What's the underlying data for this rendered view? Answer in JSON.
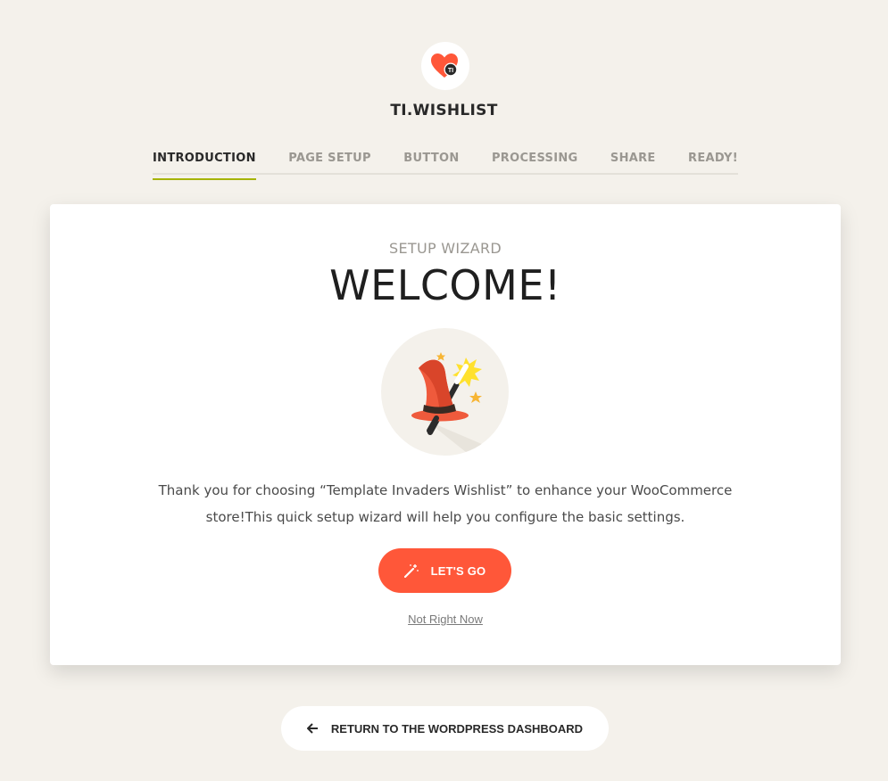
{
  "brand": {
    "name": "TI.WISHLIST",
    "logo_icon": "heart-logo-icon",
    "logo_text": "TI",
    "logo_color": "#ff5739"
  },
  "steps": [
    {
      "label": "INTRODUCTION",
      "active": true
    },
    {
      "label": "PAGE SETUP",
      "active": false
    },
    {
      "label": "BUTTON",
      "active": false
    },
    {
      "label": "PROCESSING",
      "active": false
    },
    {
      "label": "SHARE",
      "active": false
    },
    {
      "label": "READY!",
      "active": false
    }
  ],
  "card": {
    "subtitle": "SETUP WIZARD",
    "title": "WELCOME!",
    "illustration_icon": "wizard-hat-icon",
    "description": "Thank you for choosing “Template Invaders Wishlist” to enhance your WooCommerce store!This quick setup wizard will help you configure the basic settings.",
    "primary_button": {
      "label": "LET'S GO",
      "icon": "magic-wand-icon"
    },
    "skip_link": "Not Right Now"
  },
  "footer": {
    "return_button": {
      "label": "RETURN TO THE WORDPRESS DASHBOARD",
      "icon": "arrow-left-icon"
    }
  },
  "colors": {
    "background": "#f4f1eb",
    "accent": "#ff5739",
    "active_underline": "#a5b300"
  }
}
